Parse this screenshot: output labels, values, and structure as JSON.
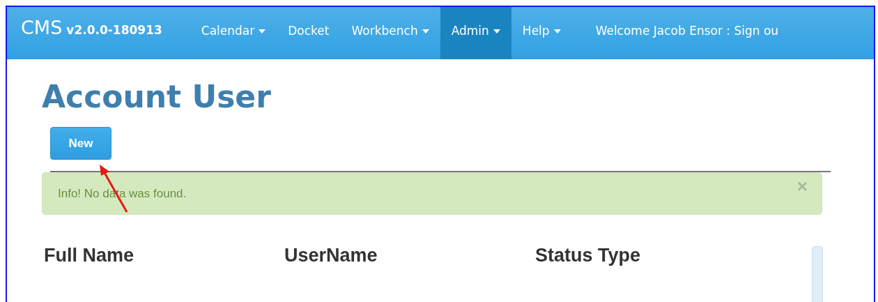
{
  "navbar": {
    "brand": "CMS",
    "version": "v2.0.0-180913",
    "items": [
      {
        "label": "Calendar",
        "dropdown": true,
        "selected": false
      },
      {
        "label": "Docket",
        "dropdown": false,
        "selected": false
      },
      {
        "label": "Workbench",
        "dropdown": true,
        "selected": false
      },
      {
        "label": "Admin",
        "dropdown": true,
        "selected": true
      },
      {
        "label": "Help",
        "dropdown": true,
        "selected": false
      }
    ],
    "welcome": "Welcome Jacob Ensor : Sign ou"
  },
  "page": {
    "title": "Account User",
    "new_button": "New",
    "alert": {
      "text": "Info! No data was found.",
      "close": "×"
    },
    "table": {
      "columns": [
        "Full Name",
        "UserName",
        "Status Type"
      ]
    }
  }
}
